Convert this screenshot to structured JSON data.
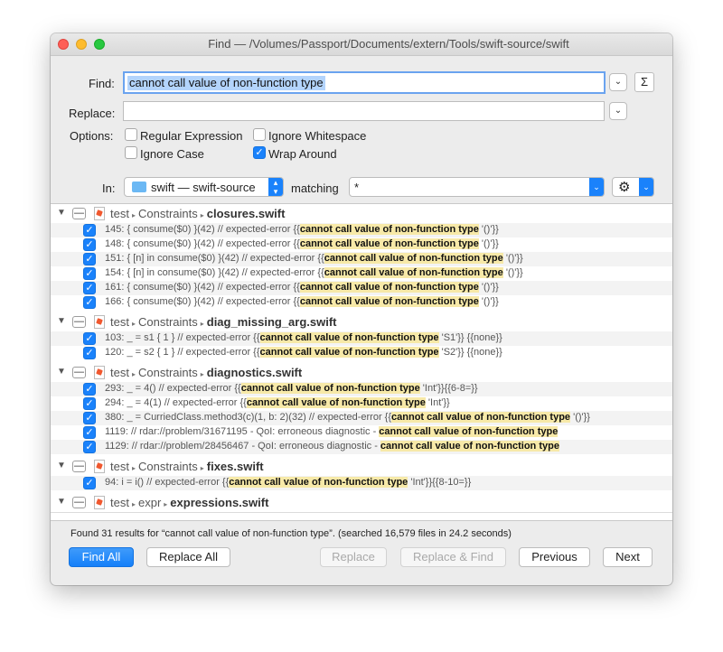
{
  "window": {
    "title": "Find — /Volumes/Passport/Documents/extern/Tools/swift-source/swift"
  },
  "find": {
    "label": "Find:",
    "value": "cannot call value of non-function type",
    "sigma": "Σ"
  },
  "replace": {
    "label": "Replace:",
    "value": ""
  },
  "options": {
    "label": "Options:",
    "items": [
      {
        "label": "Regular Expression",
        "checked": false
      },
      {
        "label": "Ignore Whitespace",
        "checked": false
      },
      {
        "label": "Ignore Case",
        "checked": false
      },
      {
        "label": "Wrap Around",
        "checked": true
      }
    ]
  },
  "scope": {
    "in_label": "In:",
    "folder": "swift — swift-source",
    "matching_label": "matching",
    "pattern": "*"
  },
  "groups": [
    {
      "dir1": "test",
      "dir2": "Constraints",
      "file": "closures.swift",
      "matches": [
        {
          "pre": "145:   { consume($0) }(42)  // expected-error {{",
          "hit": "cannot call value of non-function type",
          "post": " '()'}}"
        },
        {
          "pre": "148:   { consume($0) }(42)  // expected-error {{",
          "hit": "cannot call value of non-function type",
          "post": " '()'}}"
        },
        {
          "pre": "151:   { [n] in consume($0) }(42)  // expected-error {{",
          "hit": "cannot call value of non-function type",
          "post": " '()'}}"
        },
        {
          "pre": "154:   { [n] in consume($0) }(42)  // expected-error {{",
          "hit": "cannot call value of non-function type",
          "post": " '()'}}"
        },
        {
          "pre": "161:   { consume($0) }(42)  // expected-error {{",
          "hit": "cannot call value of non-function type",
          "post": " '()'}}"
        },
        {
          "pre": "166:   { consume($0) }(42)  // expected-error {{",
          "hit": "cannot call value of non-function type",
          "post": " '()'}}"
        }
      ]
    },
    {
      "dir1": "test",
      "dir2": "Constraints",
      "file": "diag_missing_arg.swift",
      "matches": [
        {
          "pre": "103: _ = s1 { 1 } // expected-error {{",
          "hit": "cannot call value of non-function type",
          "post": " 'S1'}} {{none}}"
        },
        {
          "pre": "120: _ = s2 { 1 } // expected-error {{",
          "hit": "cannot call value of non-function type",
          "post": " 'S2'}} {{none}}"
        }
      ]
    },
    {
      "dir1": "test",
      "dir2": "Constraints",
      "file": "diagnostics.swift",
      "matches": [
        {
          "pre": "293: _ = 4()   // expected-error {{",
          "hit": "cannot call value of non-function type",
          "post": " 'Int'}}{{6-8=}}"
        },
        {
          "pre": "294: _ = 4(1)  // expected-error {{",
          "hit": "cannot call value of non-function type",
          "post": " 'Int'}}"
        },
        {
          "pre": "380: _ = CurriedClass.method3(c)(1, b: 2)(32) // expected-error {{",
          "hit": "cannot call value of non-function type",
          "post": " '()'}}"
        },
        {
          "pre": "1119: // rdar://problem/31671195 - QoI: erroneous diagnostic - ",
          "hit": "cannot call value of non-function type",
          "post": ""
        },
        {
          "pre": "1129: // rdar://problem/28456467 - QoI: erroneous diagnostic - ",
          "hit": "cannot call value of non-function type",
          "post": ""
        }
      ]
    },
    {
      "dir1": "test",
      "dir2": "Constraints",
      "file": "fixes.swift",
      "matches": [
        {
          "pre": "94:   i = i() // expected-error {{",
          "hit": "cannot call value of non-function type",
          "post": " 'Int'}}{{8-10=}}"
        }
      ]
    },
    {
      "dir1": "test",
      "dir2": "expr",
      "file": "expressions.swift",
      "matches": []
    }
  ],
  "status": "Found 31 results for “cannot call value of non-function type”. (searched 16,579 files in 24.2 seconds)",
  "buttons": {
    "find_all": "Find All",
    "replace_all": "Replace All",
    "replace": "Replace",
    "replace_find": "Replace & Find",
    "previous": "Previous",
    "next": "Next"
  }
}
